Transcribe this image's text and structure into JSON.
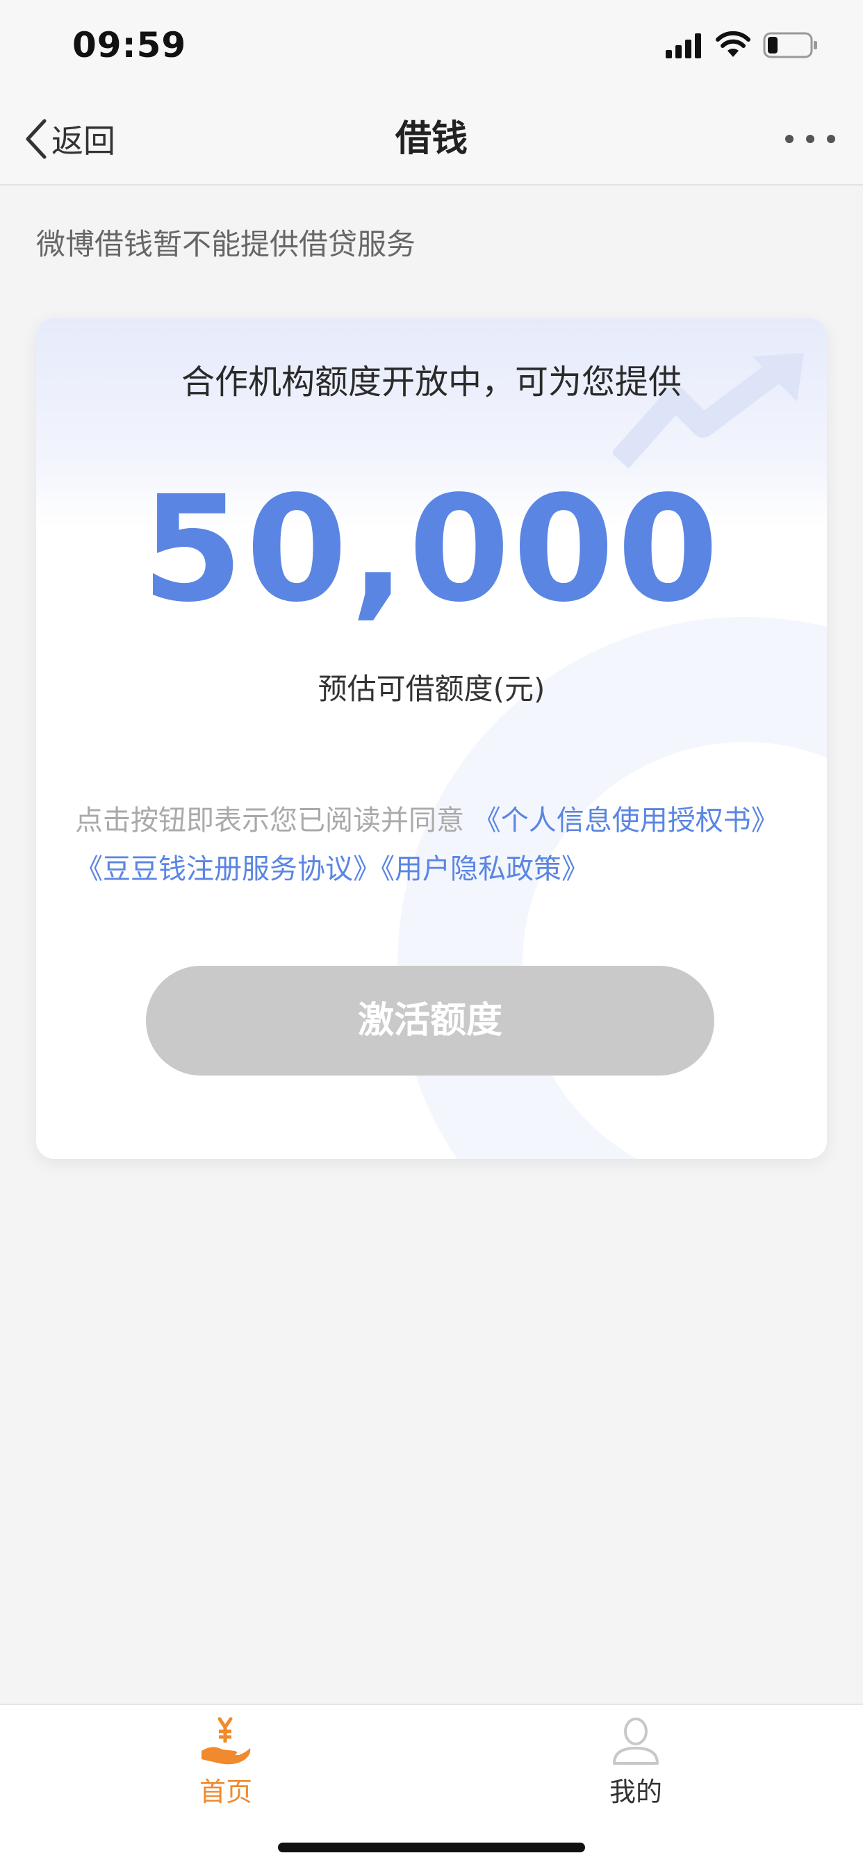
{
  "status_bar": {
    "time": "09:59"
  },
  "nav": {
    "back_label": "返回",
    "title": "借钱"
  },
  "notice": "微博借钱暂不能提供借贷服务",
  "card": {
    "subtitle": "合作机构额度开放中，可为您提供",
    "amount": "50,000",
    "amount_label": "预估可借额度(元)",
    "agreement_prefix": "点击按钮即表示您已阅读并同意",
    "links": [
      "《个人信息使用授权书》",
      "《豆豆钱注册服务协议》",
      "《用户隐私政策》"
    ],
    "button_label": "激活额度"
  },
  "tabs": [
    {
      "label": "首页",
      "icon": "hand-yen-icon",
      "active": true
    },
    {
      "label": "我的",
      "icon": "user-icon",
      "active": false
    }
  ],
  "colors": {
    "accent": "#5a85e3",
    "tab_active": "#f08a2c",
    "button_disabled": "#c9c9c9"
  }
}
